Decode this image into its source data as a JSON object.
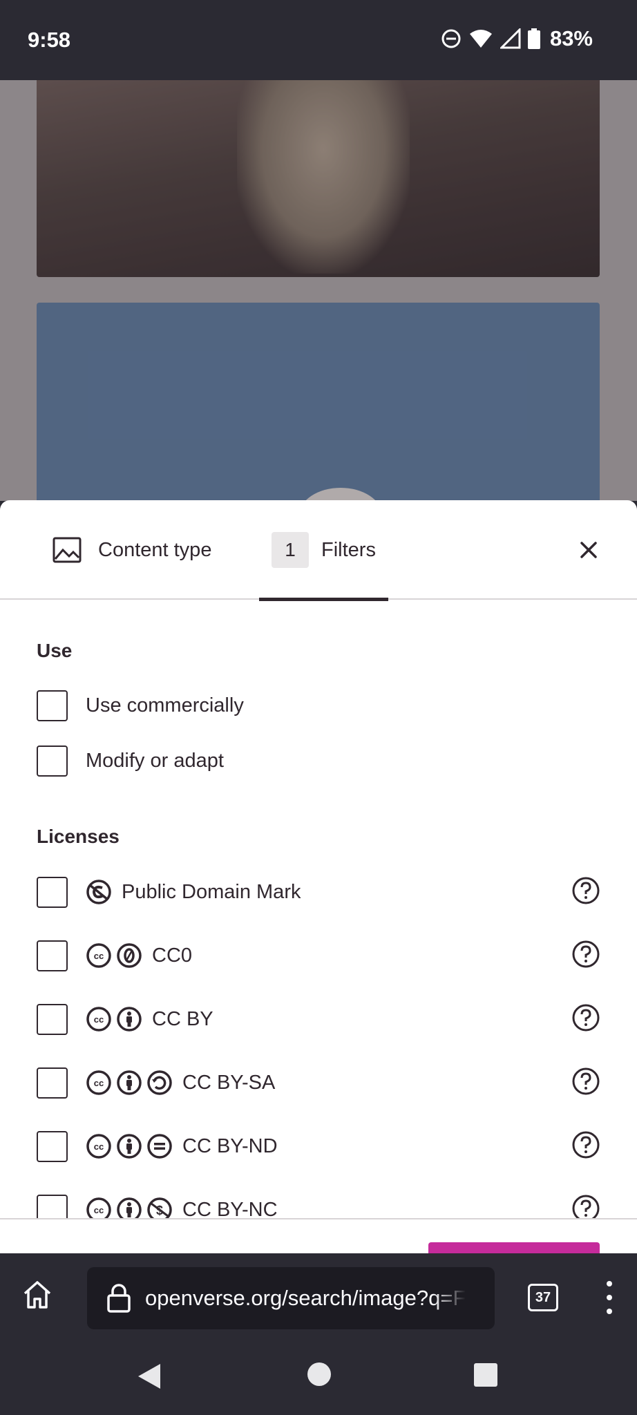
{
  "status_bar": {
    "time": "9:58",
    "battery": "83%"
  },
  "modal": {
    "tabs": [
      {
        "label": "Content type",
        "icon": "image-icon"
      },
      {
        "label": "Filters",
        "count": "1",
        "active": true
      }
    ],
    "close_icon": "close-icon",
    "use_section": {
      "title": "Use",
      "options": [
        {
          "label": "Use commercially",
          "checked": false
        },
        {
          "label": "Modify or adapt",
          "checked": false
        }
      ]
    },
    "licenses_section": {
      "title": "Licenses",
      "options": [
        {
          "label": "Public Domain Mark",
          "icons": [
            "pdm-icon"
          ],
          "checked": false
        },
        {
          "label": "CC0",
          "icons": [
            "cc-icon",
            "zero-icon"
          ],
          "checked": false
        },
        {
          "label": "CC BY",
          "icons": [
            "cc-icon",
            "by-icon"
          ],
          "checked": false
        },
        {
          "label": "CC BY-SA",
          "icons": [
            "cc-icon",
            "by-icon",
            "sa-icon"
          ],
          "checked": false
        },
        {
          "label": "CC BY-ND",
          "icons": [
            "cc-icon",
            "by-icon",
            "nd-icon"
          ],
          "checked": false
        },
        {
          "label": "CC BY-NC",
          "icons": [
            "cc-icon",
            "by-icon",
            "nc-icon"
          ],
          "checked": false
        }
      ]
    },
    "apply_button_color": "#c52b9b"
  },
  "browser": {
    "url": "openverse.org/search/image?q=F",
    "tab_count": "37"
  }
}
